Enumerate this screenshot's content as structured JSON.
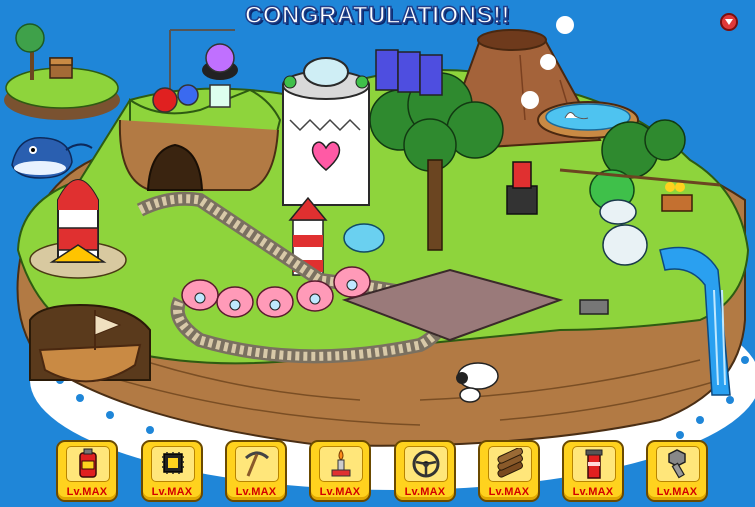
{
  "title": "CONGRATULATIONS!!",
  "close_button": {
    "icon": "close-icon"
  },
  "scene": {
    "icons": [
      "volcano-icon",
      "rocket-icon",
      "ship-icon",
      "whale-icon",
      "dome-tower-icon",
      "lab-apparatus-icon",
      "train-icon",
      "sheep-icon",
      "pool-icon",
      "waterfall-icon",
      "robot-icon",
      "treasure-island-icon"
    ]
  },
  "toolbar": {
    "items": [
      {
        "icon": "fuel-can-icon",
        "level": "Lv.MAX"
      },
      {
        "icon": "chip-icon",
        "level": "Lv.MAX"
      },
      {
        "icon": "pickaxe-icon",
        "level": "Lv.MAX"
      },
      {
        "icon": "lamp-icon",
        "level": "Lv.MAX"
      },
      {
        "icon": "steering-wheel-icon",
        "level": "Lv.MAX"
      },
      {
        "icon": "logs-icon",
        "level": "Lv.MAX"
      },
      {
        "icon": "chimney-icon",
        "level": "Lv.MAX"
      },
      {
        "icon": "bolt-icon",
        "level": "Lv.MAX"
      }
    ]
  },
  "colors": {
    "sea": "#1a7fd4",
    "grass": "#8ed43c",
    "cliff": "#b27a44",
    "button": "#ffd21e",
    "level_text": "#d40000"
  }
}
